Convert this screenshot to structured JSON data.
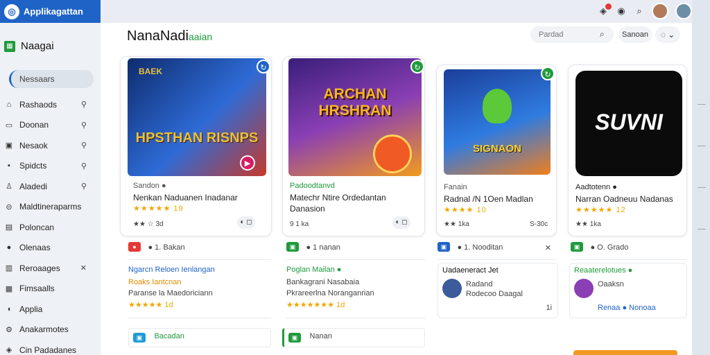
{
  "app": {
    "name": "Applikagattan",
    "workspace": "Naagai"
  },
  "sidebar": {
    "active": "Nessaars",
    "items": [
      {
        "label": "Rashaods",
        "icon": "home-icon",
        "pinned": true
      },
      {
        "label": "Doonan",
        "icon": "folder-icon",
        "pinned": true
      },
      {
        "label": "Nesaok",
        "icon": "monitor-icon",
        "pinned": true
      },
      {
        "label": "Spidcts",
        "icon": "box-icon",
        "pinned": true
      },
      {
        "label": "Aladedi",
        "icon": "user-icon",
        "pinned": true
      },
      {
        "label": "Maldtineraparms",
        "icon": "link-icon",
        "pinned": false
      },
      {
        "label": "Poloncan",
        "icon": "calendar-icon",
        "pinned": false
      },
      {
        "label": "Olenaas",
        "icon": "person-icon",
        "pinned": false
      },
      {
        "label": "Reroaages",
        "icon": "chart-icon",
        "pinned": false,
        "closable": true
      },
      {
        "label": "Fimsaalls",
        "icon": "grid-icon",
        "pinned": false
      },
      {
        "label": "Applia",
        "icon": "phone-icon",
        "pinned": false
      },
      {
        "label": "Anakarmotes",
        "icon": "tools-icon",
        "pinned": false
      },
      {
        "label": "Cin Padadanes",
        "icon": "doc-icon",
        "pinned": false
      }
    ]
  },
  "header": {
    "title": "NanaNadi",
    "title_accent": "aaian"
  },
  "search": {
    "placeholder": "Pardad"
  },
  "toolbar": {
    "pill_label": "Sanoan",
    "chat_label": "⌄"
  },
  "cards": [
    {
      "art_text": "HPSTHAN RISNPS",
      "art_top": "BAEK",
      "sub": "Sandon ●",
      "title": "Nenkan Naduanen Inadanar",
      "stars": "★★★★★ 19",
      "meta": "★★ ☆ 3d",
      "colors": {
        "bg": "#1d3f8a",
        "accent": "#e8c13a",
        "badge": "#1f63c6"
      }
    },
    {
      "art_text": "ARCHAN HRSHRAN",
      "art_top": "",
      "sub": "Padoodtanvd",
      "title": "Matechr Ntire Ordedantan",
      "title2": "Danasion",
      "stars": "",
      "meta": "9 1 ka",
      "colors": {
        "bg": "#6a3aa8",
        "accent": "#f39c1f",
        "badge": "#1f9a3c"
      }
    },
    {
      "art_text": "SIGNAON",
      "art_top": "",
      "sub": "Fanain",
      "title": "Radnal /N 1Oen Madlan",
      "stars": "★★★★ 10",
      "meta": "★★ 1ka",
      "meta2": "S-30c",
      "colors": {
        "bg": "#1e5fb8",
        "accent": "#58c43a",
        "badge": "#1f9a3c"
      }
    },
    {
      "art_text": "SUVNI",
      "art_top": "",
      "sub": "Aadtotenn ●",
      "title": "Narran Oadneuu Nadanas",
      "stars": "★★★★★ 12",
      "meta": "★★ 1ka",
      "colors": {
        "bg": "#0b0b0b",
        "accent": "#ffffff",
        "badge": "#1f9a3c"
      }
    }
  ],
  "rows": [
    {
      "r1": "● 1. Bakan",
      "r2_head": "Ngarcn Reloen Ienlangan",
      "r2_sub": "Roaks Iantcnan",
      "r2_body": "Paranse la Maedoriciann",
      "r2_stars": "★★★★★ 1d",
      "r3": "Bacadan"
    },
    {
      "r1": "● 1 nanan",
      "r2_head": "Poglan Mailan ●",
      "r2_sub": "Bankagrani Nasabaia",
      "r2_body": "Pkrareerlna Noranganrian",
      "r2_stars": "★★★★★★★ 1d",
      "r3": "Nanan"
    },
    {
      "r1": "● 1. Nooditan",
      "r2_head": "Uadaeneract Jet",
      "r2_sub": "Radand",
      "r2_body": "Rodecoo Daagal",
      "r2_stars": "",
      "r3": "1i"
    },
    {
      "r1": "● O. Grado",
      "r2_head": "Reaaterelotues ●",
      "r2_sub": "Oaaksn",
      "r2_body": "Renaa ● Nonoaa",
      "r2_stars": "",
      "r3": ""
    }
  ]
}
